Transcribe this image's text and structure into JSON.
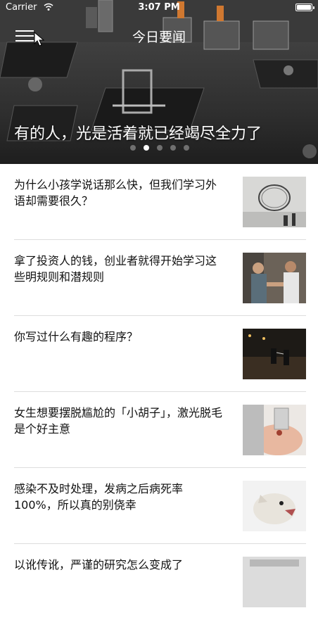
{
  "status_bar": {
    "carrier": "Carrier",
    "time": "3:07 PM"
  },
  "nav": {
    "title": "今日要闻",
    "menu_icon": "menu-icon"
  },
  "hero": {
    "headline": "有的人，光是活着就已经竭尽全力了",
    "page_count": 5,
    "active_page": 2
  },
  "news": [
    {
      "title": "为什么小孩学说话那么快，但我们学习外语却需要很久？",
      "thumb": "coffee-ring-image"
    },
    {
      "title": "拿了投资人的钱，创业者就得开始学习这些明规则和潜规则",
      "thumb": "handshake-image"
    },
    {
      "title": "你写过什么有趣的程序？",
      "thumb": "fencing-night-image"
    },
    {
      "title": "女生想要摆脱尴尬的「小胡子」，激光脱毛是个好主意",
      "thumb": "laser-treatment-image"
    },
    {
      "title": "感染不及时处理，发病之后病死率100%，所以真的别侥幸",
      "thumb": "dog-image"
    },
    {
      "title": "以讹传讹，严谨的研究怎么变成了",
      "thumb": "partial-image"
    }
  ]
}
